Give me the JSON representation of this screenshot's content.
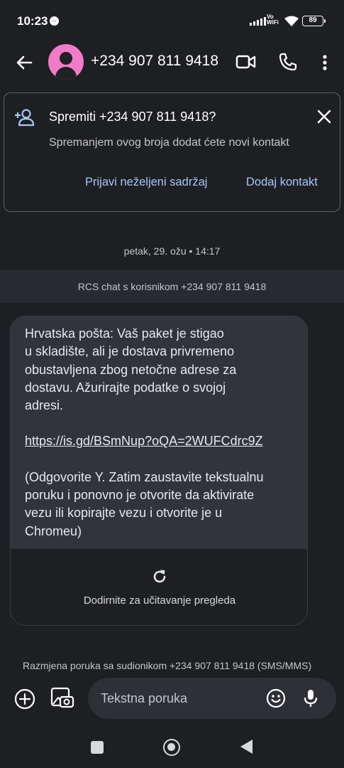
{
  "status_bar": {
    "time": "10:23",
    "vowifi_top": "Vo",
    "vowifi_bottom": "WiFi",
    "battery": "89"
  },
  "top_bar": {
    "contact": "+234 907 811 9418",
    "icons": [
      "back-icon",
      "avatar",
      "video-call-icon",
      "phone-icon",
      "more-vert-icon"
    ]
  },
  "save_card": {
    "title": "Spremiti +234 907 811 9418?",
    "description": "Spremanjem ovog broja dodat ćete novi kontakt",
    "report_label": "Prijavi neželjeni sadržaj",
    "add_contact_label": "Dodaj kontakt"
  },
  "conversation": {
    "date": "petak, 29. ožu • 14:17",
    "rcs_label": "RCS chat s korisnikom +234 907 811 9418",
    "message": {
      "lines_1": [
        "Hrvatska pošta: Vaš paket je stigao",
        "u skladište, ali je dostava privremeno",
        "obustavljena zbog netočne adrese za",
        "dostavu. Ažurirajte podatke o svojoj",
        "adresi."
      ],
      "link": "https://is.gd/BSmNup?oQA=2WUFCdrc9Z",
      "lines_2": [
        "(Odgovorite Y. Zatim zaustavite tekstualnu",
        "poruku i ponovno je otvorite da aktivirate",
        "vezu ili kopirajte vezu i otvorite je u",
        "Chromeu)"
      ]
    },
    "preview_label": "Dodirnite za učitavanje pregleda",
    "exchange_label": "Razmjena poruka sa sudionikom +234 907 811 9418 (SMS/MMS)"
  },
  "composer": {
    "placeholder": "Tekstna poruka"
  },
  "colors": {
    "background": "#1e1f23",
    "accent_link": "#a8c7fa",
    "avatar": "#f27bc9",
    "bubble": "#32343b"
  }
}
